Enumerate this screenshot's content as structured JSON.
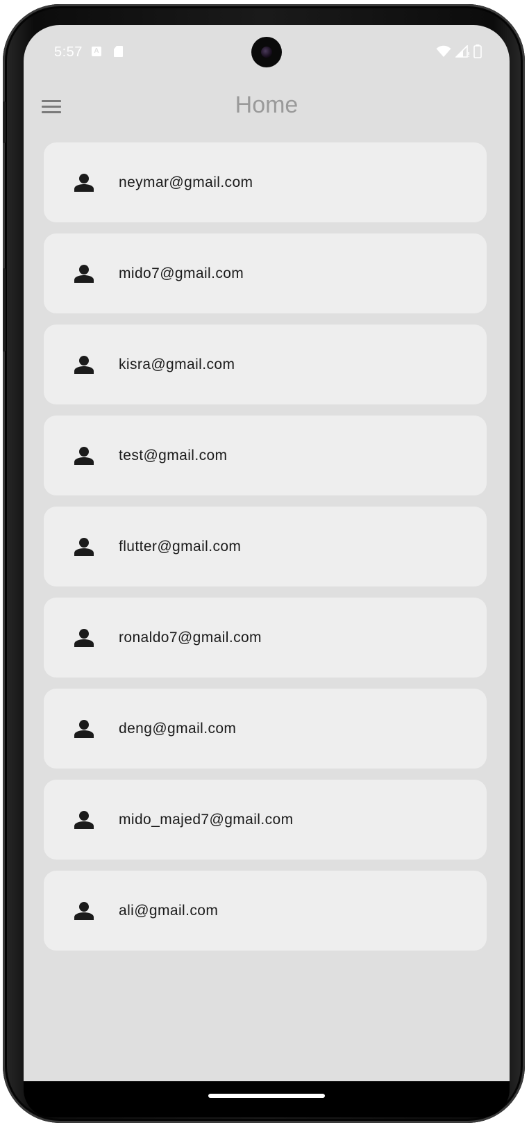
{
  "status_bar": {
    "time": "5:57",
    "notification_a_label": "A"
  },
  "app_bar": {
    "title": "Home"
  },
  "users": [
    {
      "email": "neymar@gmail.com"
    },
    {
      "email": "mido7@gmail.com"
    },
    {
      "email": "kisra@gmail.com"
    },
    {
      "email": "test@gmail.com"
    },
    {
      "email": "flutter@gmail.com"
    },
    {
      "email": "ronaldo7@gmail.com"
    },
    {
      "email": "deng@gmail.com"
    },
    {
      "email": "mido_majed7@gmail.com"
    },
    {
      "email": "ali@gmail.com"
    }
  ],
  "icons": {
    "menu": "hamburger-menu-icon",
    "list_item": "person-icon",
    "status": [
      "notification-a-icon",
      "sd-card-icon",
      "wifi-icon",
      "signal-icon",
      "battery-icon"
    ]
  },
  "colors": {
    "background": "#dfdfdf",
    "card": "#eeeeee",
    "title": "#9a9a9a",
    "text": "#1b1b1b",
    "icon": "#1b1b1b"
  }
}
